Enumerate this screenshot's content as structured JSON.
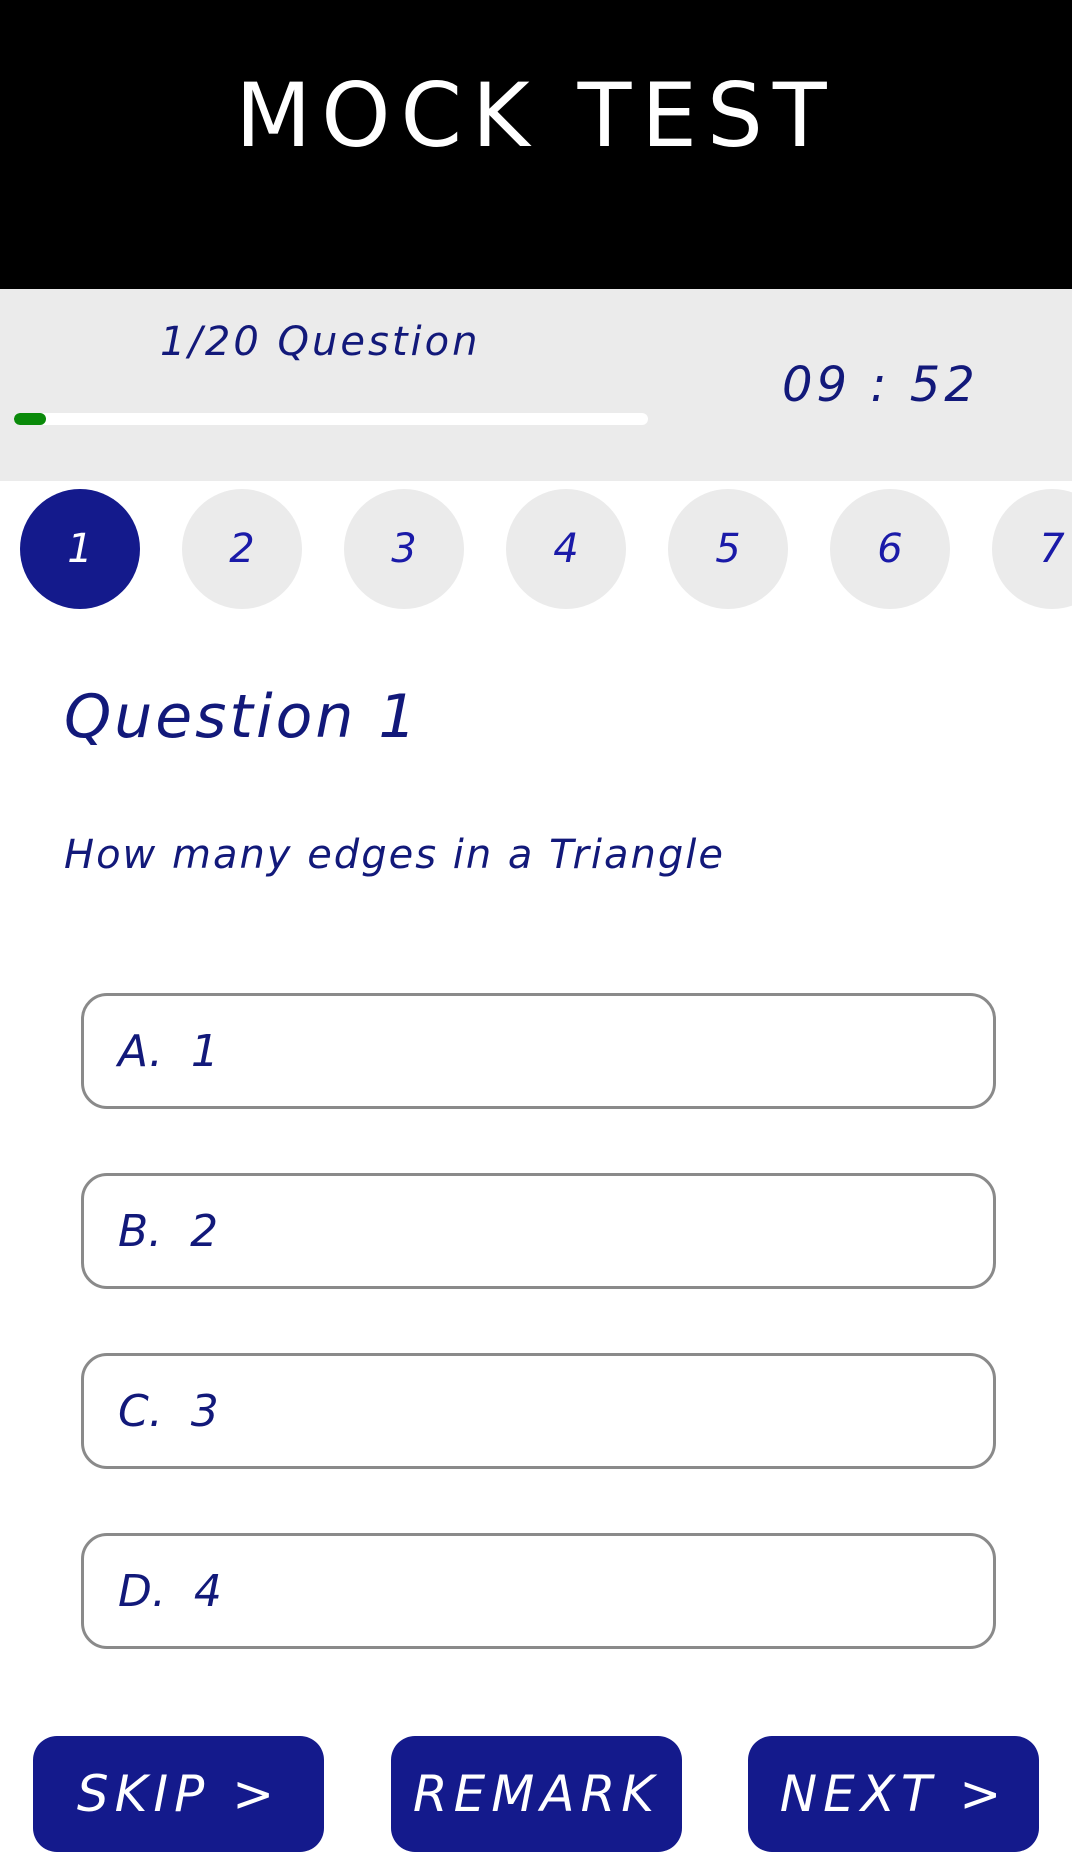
{
  "header": {
    "title": "MOCK TEST"
  },
  "status": {
    "question_counter": "1/20 Question",
    "progress_fraction": 0.05,
    "timer": "09 : 52"
  },
  "question_nav": [
    "1",
    "2",
    "3",
    "4",
    "5",
    "6",
    "7"
  ],
  "question": {
    "title": "Question 1",
    "text": "How many edges in a Triangle"
  },
  "options": [
    {
      "letter": "A.",
      "value": "1"
    },
    {
      "letter": "B.",
      "value": "2"
    },
    {
      "letter": "C.",
      "value": "3"
    },
    {
      "letter": "D.",
      "value": "4"
    }
  ],
  "actions": {
    "skip_label": "SKIP >",
    "remark_label": "REMARK",
    "next_label": "NEXT >"
  },
  "colors": {
    "header_bg": "#000000",
    "accent": "#141a8c",
    "progress": "#0a8a0a",
    "status_bg": "#ebebeb"
  }
}
